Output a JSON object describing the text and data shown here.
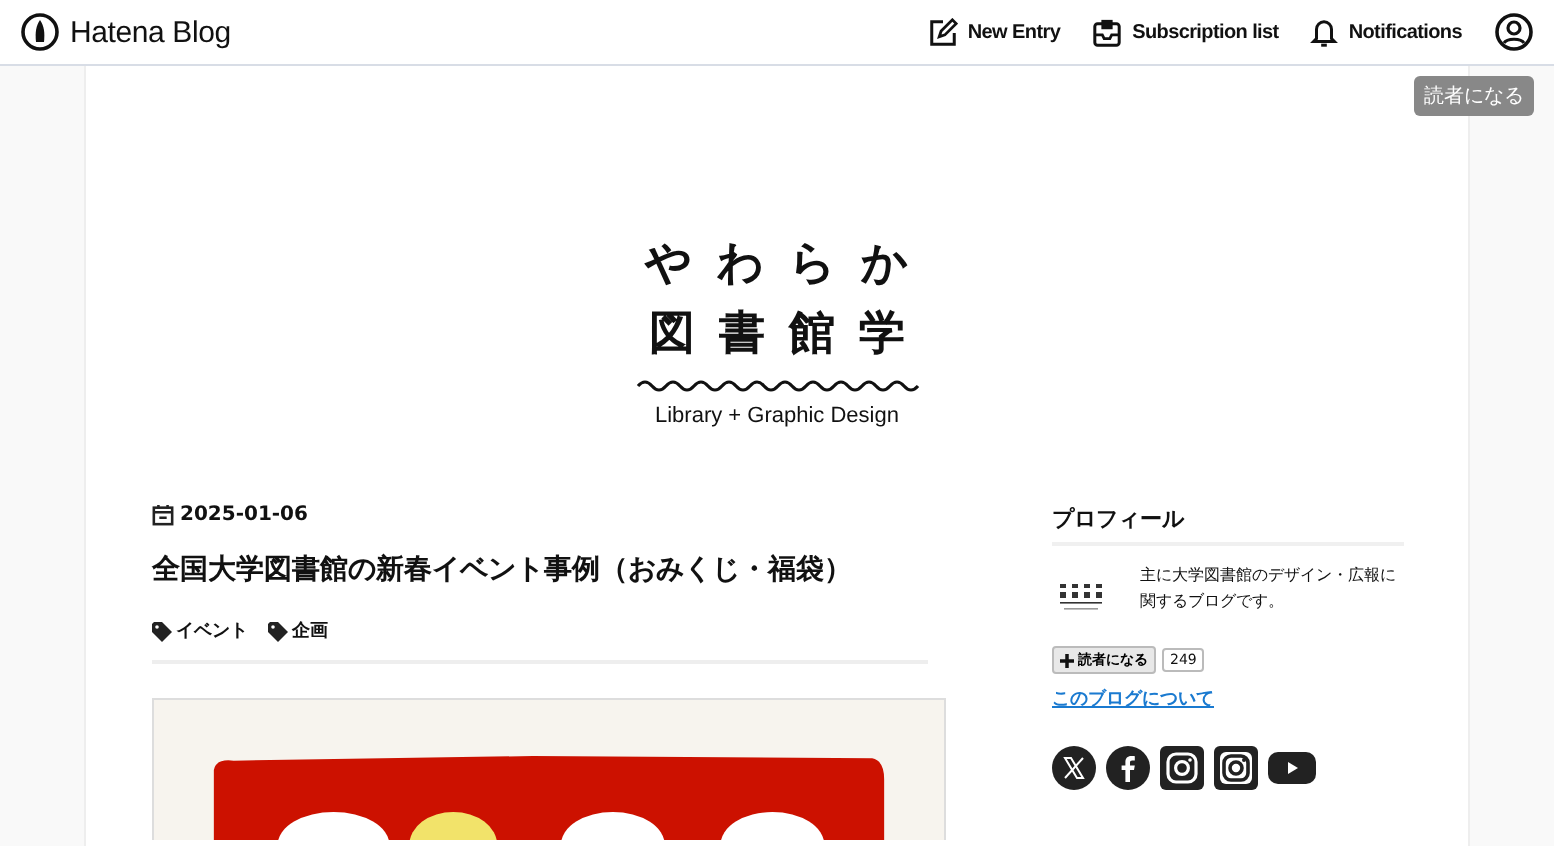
{
  "header": {
    "brand": "Hatena Blog",
    "nav": [
      {
        "kind": "edit",
        "label": "New Entry"
      },
      {
        "kind": "inbox",
        "label": "Subscription list"
      },
      {
        "kind": "bell",
        "label": "Notifications"
      }
    ]
  },
  "floating_button": "読者になる",
  "blog_title": {
    "line_1": "やわらか",
    "line_2": "図書館学",
    "subtitle": "Library + Graphic Design"
  },
  "entry": {
    "date": "2025-01-06",
    "title": "全国大学図書館の新春イベント事例（おみくじ・福袋）",
    "tags": [
      "イベント",
      "企画"
    ],
    "image": {
      "kind": "picture"
    }
  },
  "sidebar": {
    "heading": "プロフィール",
    "description": "主に大学図書館のデザイン・広報に関するブログです。",
    "subscribe_button": "読者になる",
    "subscriber_count": "249",
    "about_link": "このブログについて",
    "social": [
      {
        "kind": "x"
      },
      {
        "kind": "facebook"
      },
      {
        "kind": "instagram"
      },
      {
        "kind": "instagram-alt"
      },
      {
        "kind": "youtube"
      }
    ]
  }
}
